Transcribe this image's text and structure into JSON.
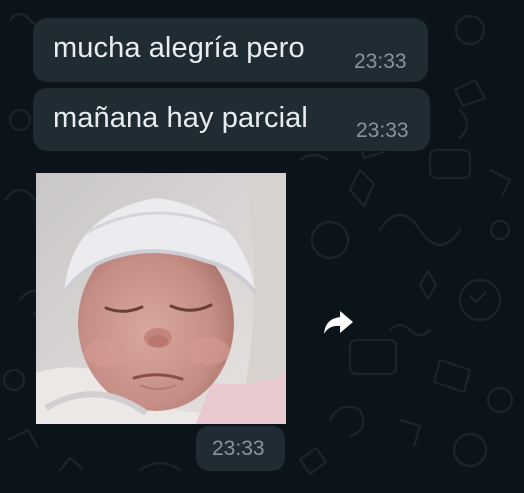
{
  "theme": {
    "background": "#0b141a",
    "bubble_incoming": "#1f2c33",
    "text_primary": "#e9edef",
    "text_meta": "#8696a0"
  },
  "messages": [
    {
      "text": "mucha alegría pero",
      "time": "23:33"
    },
    {
      "text": "mañana hay parcial",
      "time": "23:33"
    }
  ],
  "sticker": {
    "icon": "sleepy-newborn-baby-sticker",
    "time": "23:33"
  },
  "actions": {
    "forward_icon": "forward-arrow-icon"
  }
}
